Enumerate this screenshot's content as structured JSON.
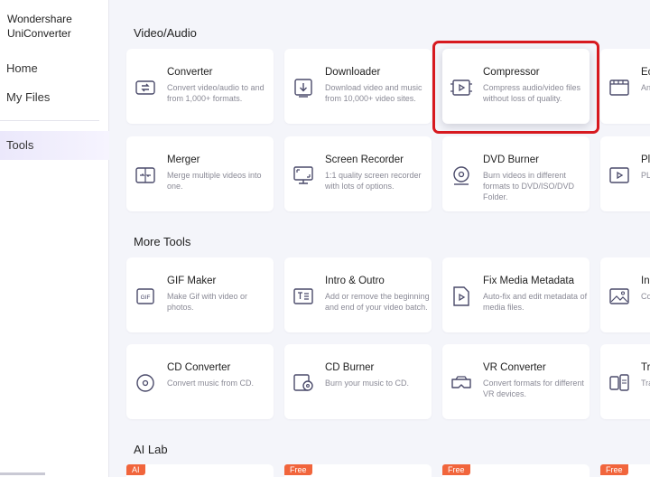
{
  "app": {
    "name_line1": "Wondershare",
    "name_line2": "UniConverter"
  },
  "sidebar": {
    "items": [
      {
        "label": "Home"
      },
      {
        "label": "My Files"
      },
      {
        "label": "Tools"
      }
    ]
  },
  "sections": {
    "video_audio": "Video/Audio",
    "more_tools": "More Tools",
    "ai_lab": "AI Lab"
  },
  "video_audio": [
    {
      "title": "Converter",
      "desc": "Convert video/audio to and from 1,000+ formats."
    },
    {
      "title": "Downloader",
      "desc": "Download video and music from 10,000+ video sites."
    },
    {
      "title": "Compressor",
      "desc": "Compress audio/video files without loss of quality."
    },
    {
      "title": "Ec",
      "desc": "An ed tim"
    },
    {
      "title": "Merger",
      "desc": "Merge multiple videos into one."
    },
    {
      "title": "Screen Recorder",
      "desc": "1:1 quality screen recorder with lots of options."
    },
    {
      "title": "DVD Burner",
      "desc": "Burn videos in different formats to DVD/ISO/DVD Folder."
    },
    {
      "title": "Pl",
      "desc": "PL vid"
    }
  ],
  "more_tools": [
    {
      "title": "GIF Maker",
      "desc": "Make Gif with video or photos."
    },
    {
      "title": "Intro & Outro",
      "desc": "Add or remove the beginning and end of your video batch."
    },
    {
      "title": "Fix Media Metadata",
      "desc": "Auto-fix and edit metadata of media files."
    },
    {
      "title": "In",
      "desc": "Co"
    },
    {
      "title": "CD Converter",
      "desc": "Convert music from CD."
    },
    {
      "title": "CD Burner",
      "desc": "Burn your music to CD."
    },
    {
      "title": "VR Converter",
      "desc": "Convert formats for different VR devices."
    },
    {
      "title": "Tr",
      "desc": "Tra de"
    }
  ],
  "ai_lab": [
    {
      "badge": "AI"
    },
    {
      "badge": "Free"
    },
    {
      "badge": "Free"
    },
    {
      "badge": "Free"
    }
  ],
  "colors": {
    "accent": "#7b5ff5",
    "highlight_border": "#d7191f",
    "badge": "#f1653c"
  }
}
